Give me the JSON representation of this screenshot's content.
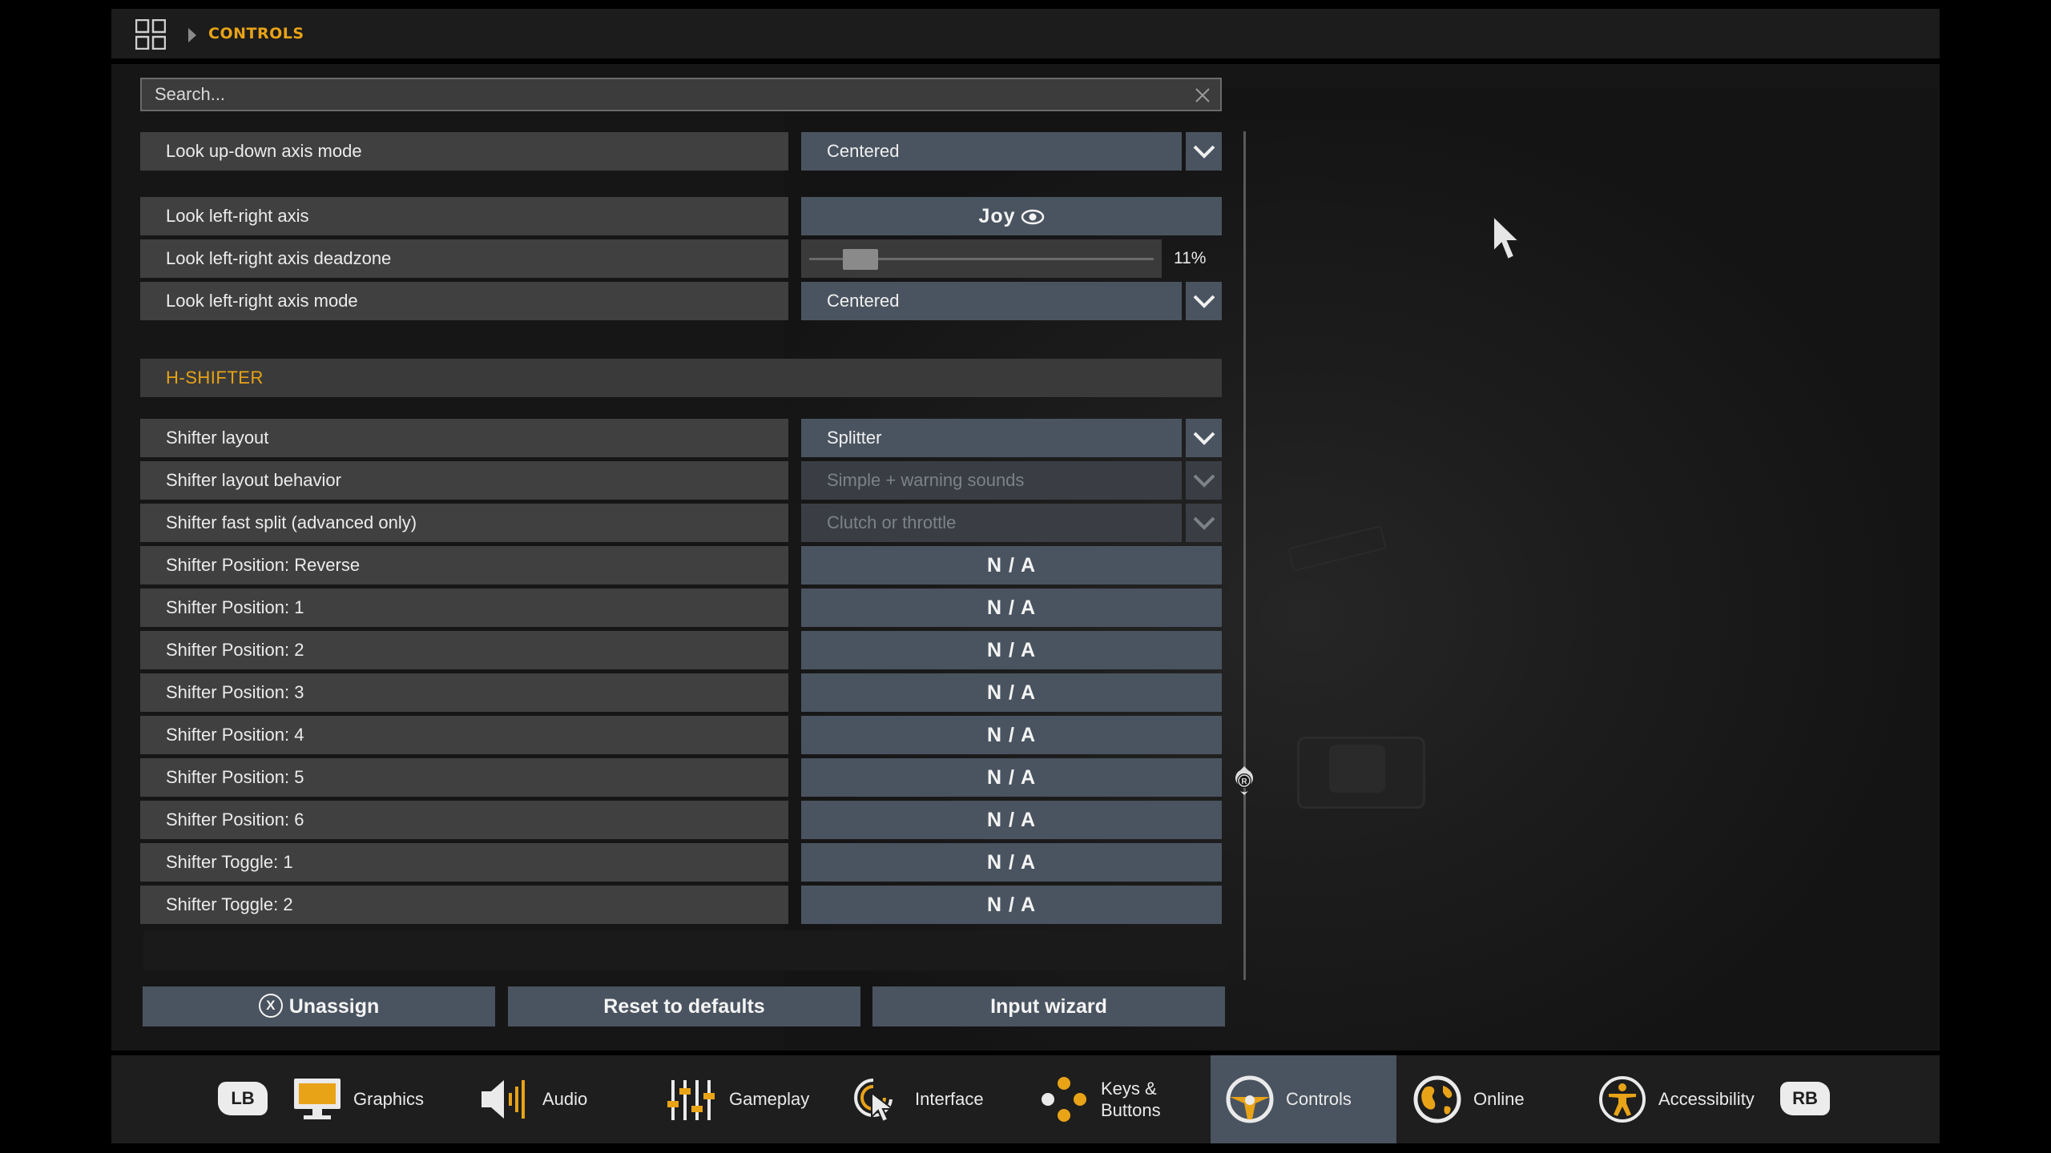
{
  "breadcrumb": {
    "current": "CONTROLS"
  },
  "search": {
    "placeholder": "Search..."
  },
  "settings": {
    "look_ud_mode": {
      "label": "Look up-down axis mode",
      "value": "Centered"
    },
    "look_lr_axis": {
      "label": "Look left-right axis",
      "value": "Joy"
    },
    "look_lr_deadzone": {
      "label": "Look left-right axis deadzone",
      "value": "11%",
      "fraction": 0.11
    },
    "look_lr_mode": {
      "label": "Look left-right axis mode",
      "value": "Centered"
    }
  },
  "h_shifter": {
    "title": "H-SHIFTER",
    "layout": {
      "label": "Shifter layout",
      "value": "Splitter"
    },
    "behavior": {
      "label": "Shifter layout behavior",
      "value": "Simple + warning sounds"
    },
    "fast_split": {
      "label": "Shifter fast split (advanced only)",
      "value": "Clutch or throttle"
    },
    "bindings": [
      {
        "label": "Shifter Position: Reverse",
        "value": "N / A"
      },
      {
        "label": "Shifter Position: 1",
        "value": "N / A"
      },
      {
        "label": "Shifter Position: 2",
        "value": "N / A"
      },
      {
        "label": "Shifter Position: 3",
        "value": "N / A"
      },
      {
        "label": "Shifter Position: 4",
        "value": "N / A"
      },
      {
        "label": "Shifter Position: 5",
        "value": "N / A"
      },
      {
        "label": "Shifter Position: 6",
        "value": "N / A"
      },
      {
        "label": "Shifter Toggle: 1",
        "value": "N / A"
      },
      {
        "label": "Shifter Toggle: 2",
        "value": "N / A"
      }
    ]
  },
  "actions": {
    "unassign_icon": "X",
    "unassign": "Unassign",
    "reset": "Reset to defaults",
    "wizard": "Input wizard"
  },
  "scroll_thumb_glyph": "R",
  "tabs": {
    "lb": "LB",
    "rb": "RB",
    "items": [
      {
        "label": "Graphics",
        "icon": "monitor-icon"
      },
      {
        "label": "Audio",
        "icon": "speaker-icon"
      },
      {
        "label": "Gameplay",
        "icon": "sliders-icon"
      },
      {
        "label": "Interface",
        "icon": "pointer-click-icon"
      },
      {
        "label": "Keys &",
        "label2": "Buttons",
        "icon": "buttons-icon"
      },
      {
        "label": "Controls",
        "icon": "steering-wheel-icon",
        "active": true
      },
      {
        "label": "Online",
        "icon": "globe-icon"
      },
      {
        "label": "Accessibility",
        "icon": "accessibility-icon"
      }
    ]
  },
  "colors": {
    "accent": "#e8a317",
    "control": "#4a5460",
    "label_bg": "#404040",
    "panel": "#161616"
  }
}
